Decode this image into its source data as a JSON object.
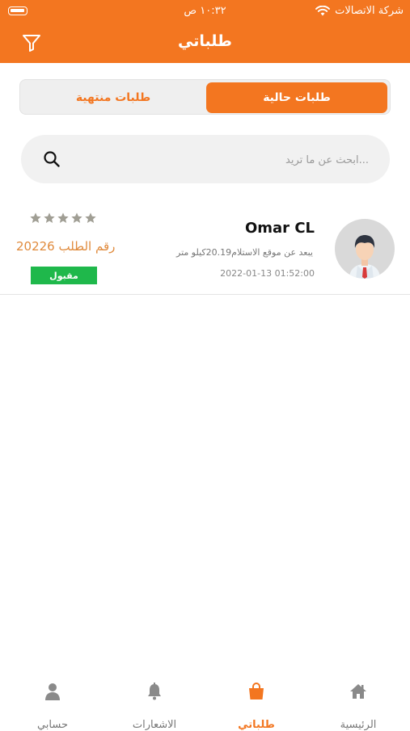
{
  "status_bar": {
    "carrier": "شركة الاتصالات",
    "time": "١٠:٣٢ ص"
  },
  "header": {
    "title": "طلباتي",
    "filter_icon": "filter-icon"
  },
  "tabs": {
    "current": "طلبات حالية",
    "finished": "طلبات منتهية",
    "active": "current"
  },
  "search": {
    "placeholder": "...ابحث عن ما تريد",
    "value": "",
    "icon": "search-icon"
  },
  "orders": [
    {
      "driver_name": "Omar CL",
      "distance_text": "يبعد عن موقع الاستلام20.19كيلو متر",
      "date": "2022-01-13 01:52:00",
      "order_number": "رقم الطلب 20226",
      "rating": 5,
      "status": "مقبول",
      "status_color": "#1FB84B"
    }
  ],
  "tab_bar": {
    "home": "الرئيسية",
    "orders": "طلباتي",
    "notifications": "الاشعارات",
    "account": "حسابي",
    "active": "orders"
  },
  "colors": {
    "primary": "#F37620",
    "star": "#A09E94",
    "accepted": "#1FB84B"
  }
}
